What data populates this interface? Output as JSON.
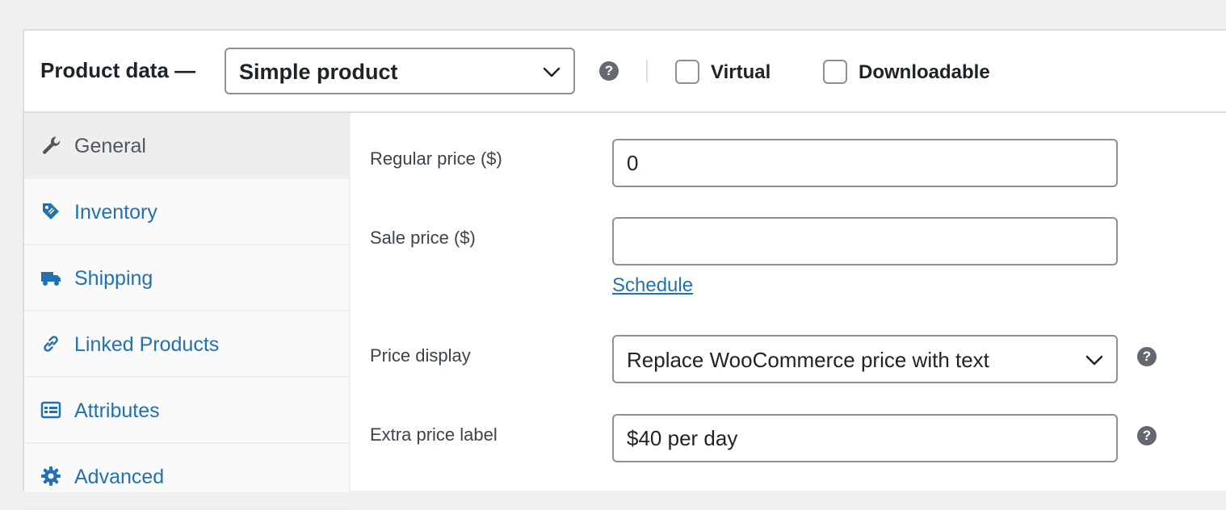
{
  "header": {
    "title": "Product data —",
    "product_type": "Simple product",
    "help_glyph": "?",
    "virtual_label": "Virtual",
    "virtual_checked": false,
    "downloadable_label": "Downloadable",
    "downloadable_checked": false
  },
  "sidebar": {
    "tabs": [
      {
        "label": "General",
        "icon": "wrench-icon",
        "active": true
      },
      {
        "label": "Inventory",
        "icon": "tag-icon",
        "active": false
      },
      {
        "label": "Shipping",
        "icon": "truck-icon",
        "active": false
      },
      {
        "label": "Linked Products",
        "icon": "link-icon",
        "active": false
      },
      {
        "label": "Attributes",
        "icon": "list-icon",
        "active": false
      },
      {
        "label": "Advanced",
        "icon": "gear-icon",
        "active": false
      }
    ]
  },
  "general": {
    "regular_price_label": "Regular price ($)",
    "regular_price_value": "0",
    "sale_price_label": "Sale price ($)",
    "sale_price_value": "",
    "schedule_link": "Schedule",
    "price_display_label": "Price display",
    "price_display_value": "Replace WooCommerce price with text",
    "extra_price_label": "Extra price label",
    "extra_price_value": "$40 per day"
  },
  "colors": {
    "link": "#2271b1",
    "active_tab_text": "#50575e",
    "help_icon": "#646970",
    "border": "#8c8f94"
  }
}
